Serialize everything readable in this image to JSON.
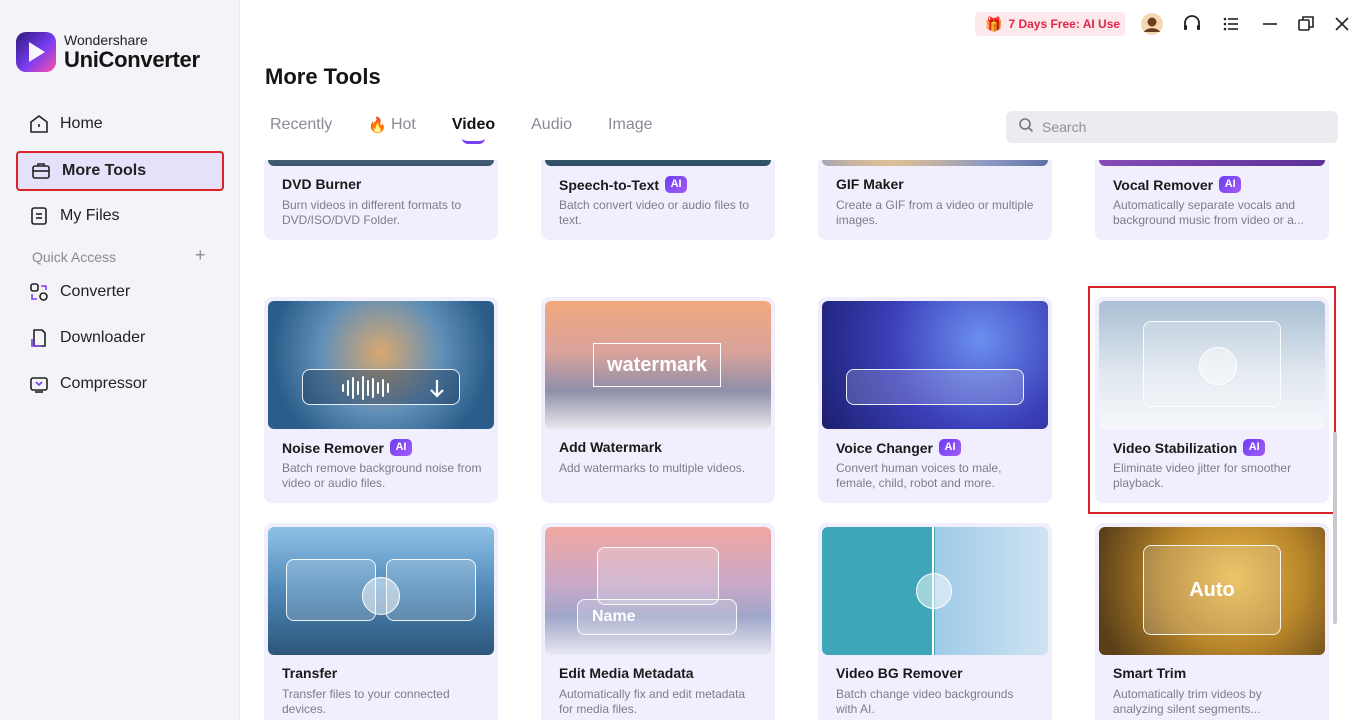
{
  "app": {
    "brand": "Wondershare",
    "product": "UniConverter"
  },
  "sidebar": {
    "items": [
      {
        "label": "Home",
        "icon": "home-icon"
      },
      {
        "label": "More Tools",
        "icon": "toolbox-icon"
      },
      {
        "label": "My Files",
        "icon": "file-icon"
      }
    ],
    "quick_access_label": "Quick Access",
    "quick_access_add": "+",
    "quick_items": [
      {
        "label": "Converter",
        "icon": "converter-icon"
      },
      {
        "label": "Downloader",
        "icon": "download-icon"
      },
      {
        "label": "Compressor",
        "icon": "compress-icon"
      }
    ]
  },
  "topbar": {
    "promo_label": "7 Days Free: AI Use"
  },
  "main": {
    "title": "More Tools",
    "tabs": [
      "Recently",
      "Hot",
      "Video",
      "Audio",
      "Image"
    ],
    "active_tab": "Video",
    "search_placeholder": "Search"
  },
  "ai_badge": "AI",
  "cards": [
    {
      "name": "DVD Burner",
      "desc": "Burn videos in different formats to DVD/ISO/DVD Folder.",
      "ai": false
    },
    {
      "name": "Speech-to-Text",
      "desc": "Batch convert video or audio files to text.",
      "ai": true
    },
    {
      "name": "GIF Maker",
      "desc": "Create a GIF from a video or multiple images.",
      "ai": false
    },
    {
      "name": "Vocal Remover",
      "desc": "Automatically separate vocals and background music from video or a...",
      "ai": true
    },
    {
      "name": "Noise Remover",
      "desc": "Batch remove background noise from video or audio files.",
      "ai": true
    },
    {
      "name": "Add Watermark",
      "desc": "Add watermarks to multiple videos.",
      "ai": false,
      "thumb_text": "watermark"
    },
    {
      "name": "Voice Changer",
      "desc": "Convert human voices to male, female, child, robot and more.",
      "ai": true
    },
    {
      "name": "Video Stabilization",
      "desc": "Eliminate video jitter for smoother playback.",
      "ai": true
    },
    {
      "name": "Transfer",
      "desc": "Transfer files to your connected devices.",
      "ai": false
    },
    {
      "name": "Edit Media Metadata",
      "desc": "Automatically fix and edit metadata for media files.",
      "ai": false,
      "thumb_text": "Name"
    },
    {
      "name": "Video BG Remover",
      "desc": "Batch change video backgrounds with AI.",
      "ai": false
    },
    {
      "name": "Smart Trim",
      "desc": "Automatically trim videos by analyzing silent segments...",
      "ai": false,
      "thumb_text": "Auto"
    }
  ]
}
